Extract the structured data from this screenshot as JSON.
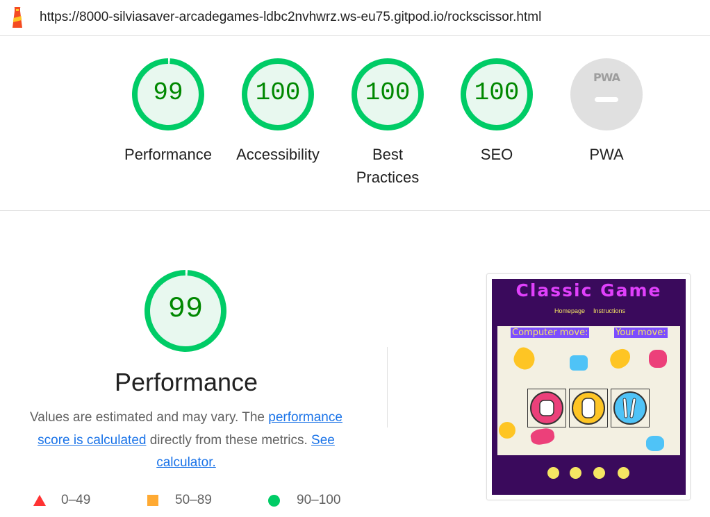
{
  "browser": {
    "url": "https://8000-silviasaver-arcadegames-ldbc2nvhwrz.ws-eu75.gitpod.io/rockscissor.html",
    "logo_icon": "lighthouse-icon"
  },
  "summary_gauges": [
    {
      "score": "99",
      "label": "Performance",
      "value": 99
    },
    {
      "score": "100",
      "label": "Accessibility",
      "value": 100
    },
    {
      "score": "100",
      "label_line1": "Best",
      "label_line2": "Practices",
      "value": 100
    },
    {
      "score": "100",
      "label": "SEO",
      "value": 100
    }
  ],
  "pwa": {
    "badge_text": "PWA",
    "label": "PWA"
  },
  "performance": {
    "score": "99",
    "value": 99,
    "title": "Performance",
    "desc_part1": "Values are estimated and may vary. The ",
    "link1": "performance score is calculated",
    "desc_part2": " directly from these metrics. ",
    "link2": "See calculator."
  },
  "legend": [
    {
      "range": "0–49",
      "shape": "triangle",
      "color": "#ff3333"
    },
    {
      "range": "50–89",
      "shape": "square",
      "color": "#ffaa33"
    },
    {
      "range": "90–100",
      "shape": "circle",
      "color": "#00cc66"
    }
  ],
  "screenshot": {
    "game_title": "Classic Game",
    "nav_home": "Homepage",
    "nav_instructions": "Instructions",
    "computer_move": "Computer move:",
    "your_move": "Your move:",
    "choices": [
      "rock-icon",
      "paper-icon",
      "scissors-icon"
    ],
    "social": [
      "facebook-icon",
      "instagram-icon",
      "youtube-icon",
      "reddit-icon"
    ]
  },
  "colors": {
    "pass_green": "#00cc66",
    "score_text_green": "#008800",
    "gauge_fill": "#e8f8ef",
    "link_blue": "#1a73e8"
  }
}
